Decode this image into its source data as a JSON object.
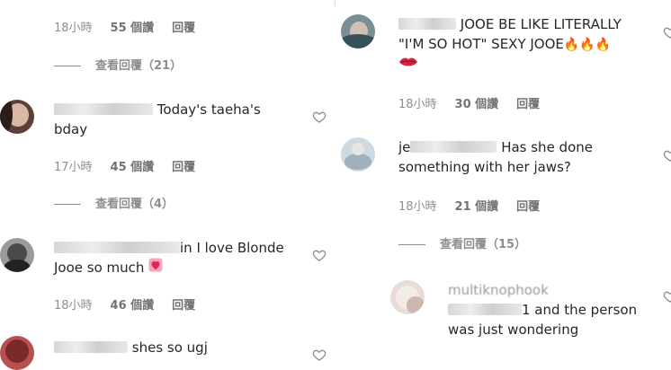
{
  "left": {
    "top_meta": {
      "time": "18小時",
      "likes": "55 個讚",
      "reply": "回覆"
    },
    "top_view_replies": "查看回覆（21）",
    "comments": [
      {
        "text": "Today's taeha's bday",
        "line2": "bday",
        "line1": "Today's taeha's",
        "time": "17小時",
        "likes": "45 個讚",
        "reply": "回覆",
        "view_replies": "查看回覆（4）"
      },
      {
        "line1": "in I love Blonde",
        "line2": "Jooe so much",
        "time": "18小時",
        "likes": "46 個讚",
        "reply": "回覆"
      },
      {
        "line1": "shes so ugj"
      }
    ]
  },
  "right": {
    "comments": [
      {
        "line1": "JOOE BE LIKE LITERALLY",
        "line2": "\"I'M SO HOT\" SEXY JOOE",
        "time": "18小時",
        "likes": "30 個讚",
        "reply": "回覆"
      },
      {
        "prefix": "je",
        "line1": "Has she done",
        "line2": "something with her jaws?",
        "time": "18小時",
        "likes": "21 個讚",
        "reply": "回覆",
        "view_replies": "查看回覆（15）"
      },
      {
        "username": "multiknophook",
        "line1": "1 and the person",
        "line2": "was just wondering"
      }
    ]
  },
  "colors": {
    "meta": "#8e8e8e",
    "text": "#262626",
    "heart_emoji": "#e0245e",
    "fire": "#ff6a00"
  }
}
